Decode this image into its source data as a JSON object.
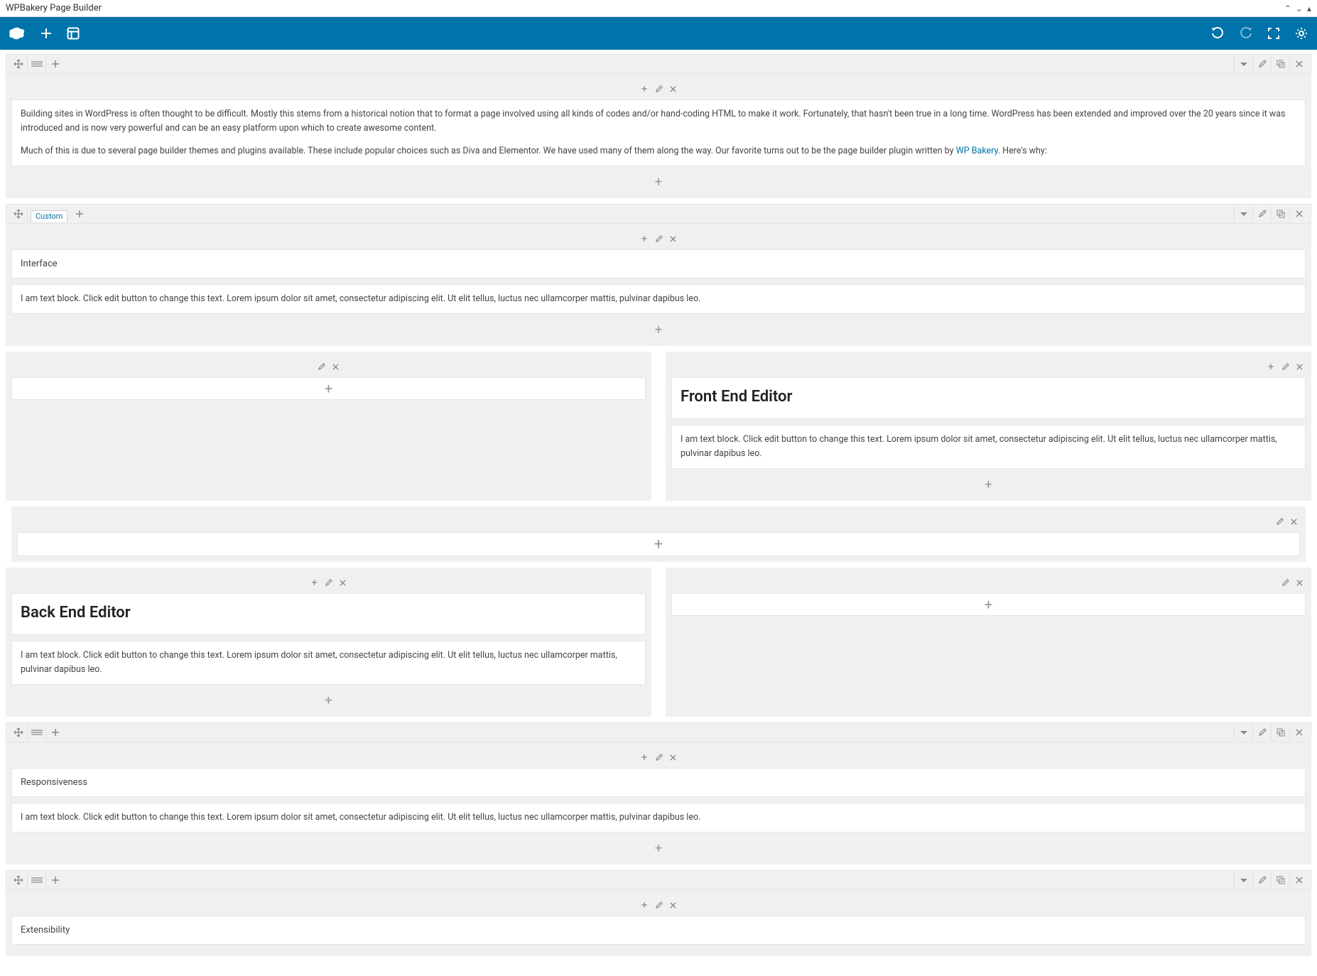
{
  "window": {
    "title": "WPBakery Page Builder"
  },
  "row1": {
    "paragraph1": "Building sites in WordPress is often thought to be difficult. Mostly this stems from a historical notion that to format a page involved using all kinds of codes and/or hand-coding HTML to make it work. Fortunately, that hasn't been true in a long time. WordPress has been extended and improved over the 20 years since it was introduced and is now very powerful and can be an easy platform upon which to create awesome content.",
    "paragraph2_pre": "Much of this is due to several page builder themes and plugins available. These include popular choices such as Diva and Elementor. We have used many of them along the way. Our favorite turns out to be the page builder plugin written by ",
    "paragraph2_link": "WP Bakery",
    "paragraph2_post": ". Here's why:"
  },
  "row2": {
    "custom_label": "Custom",
    "heading": "Interface",
    "text": "I am text block. Click edit button to change this text. Lorem ipsum dolor sit amet, consectetur adipiscing elit. Ut elit tellus, luctus nec ullamcorper mattis, pulvinar dapibus leo."
  },
  "front": {
    "heading": "Front End Editor",
    "text": "I am text block. Click edit button to change this text. Lorem ipsum dolor sit amet, consectetur adipiscing elit. Ut elit tellus, luctus nec ullamcorper mattis, pulvinar dapibus leo."
  },
  "back": {
    "heading": "Back End Editor",
    "text": "I am text block. Click edit button to change this text. Lorem ipsum dolor sit amet, consectetur adipiscing elit. Ut elit tellus, luctus nec ullamcorper mattis, pulvinar dapibus leo."
  },
  "row5": {
    "heading": "Responsiveness",
    "text": "I am text block. Click edit button to change this text. Lorem ipsum dolor sit amet, consectetur adipiscing elit. Ut elit tellus, luctus nec ullamcorper mattis, pulvinar dapibus leo."
  },
  "row6": {
    "heading": "Extensibility"
  }
}
